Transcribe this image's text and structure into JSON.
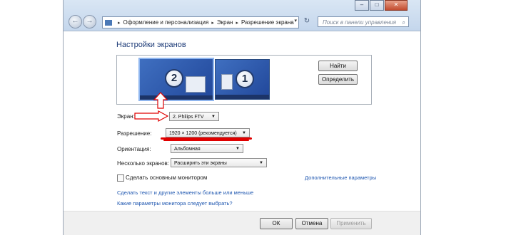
{
  "window": {
    "caption_buttons": [
      "–",
      "□",
      "✕"
    ]
  },
  "nav": {
    "back_icon": "back-arrow-icon",
    "forward_icon": "forward-arrow-icon"
  },
  "address_bar": {
    "sep": "▸",
    "crumbs": [
      "Оформление и персонализация",
      "Экран",
      "Разрешение экрана"
    ],
    "dropdown_glyph": "▾",
    "refresh_glyph": "↻"
  },
  "search": {
    "placeholder": "Поиск в панели управления",
    "icon_glyph": "⌕"
  },
  "page": {
    "title": "Настройки экранов"
  },
  "monitors": [
    {
      "number": "2",
      "selected": true
    },
    {
      "number": "1",
      "selected": false
    }
  ],
  "buttons": {
    "find": "Найти",
    "identify": "Определить"
  },
  "settings": {
    "screen_label": "Экран:",
    "screen_value": "2. Philips FTV",
    "resolution_label": "Разрешение:",
    "resolution_value": "1920 × 1200 (рекомендуется)",
    "orientation_label": "Ориентация:",
    "orientation_value": "Альбомная",
    "multi_label": "Несколько экранов:",
    "multi_value": "Расширить эти экраны",
    "dropdown_glyph": "▼"
  },
  "options": {
    "main_monitor_label": "Сделать основным монитором",
    "main_monitor_checked": false,
    "advanced_link": "Дополнительные параметры"
  },
  "links": {
    "text_size": "Сделать текст и другие элементы больше или меньше",
    "which_settings": "Какие параметры монитора следует выбрать?"
  },
  "footer": {
    "ok": "ОК",
    "cancel": "Отмена",
    "apply": "Применить"
  },
  "colors": {
    "accent": "#1e3c78",
    "link": "#1f57b0",
    "monitor": "#3f6fc0",
    "annotation": "#e00000"
  }
}
